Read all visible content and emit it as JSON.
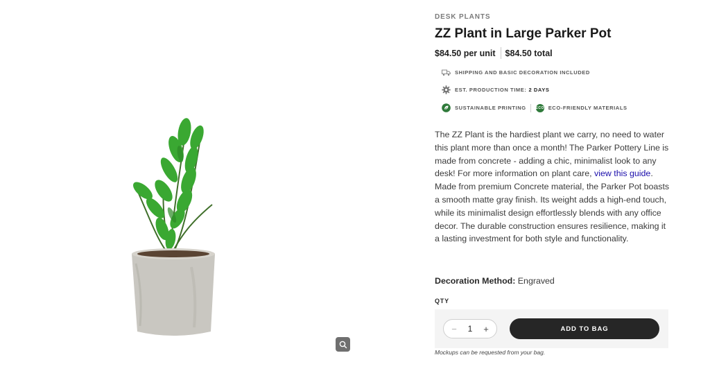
{
  "product": {
    "category": "DESK PLANTS",
    "title": "ZZ Plant in Large Parker Pot",
    "price_unit": "$84.50 per unit",
    "price_total": "$84.50 total"
  },
  "features": {
    "shipping": "SHIPPING AND BASIC DECORATION INCLUDED",
    "production_label": "EST. PRODUCTION TIME:",
    "production_value": "2 DAYS",
    "sustainable": "SUSTAINABLE PRINTING",
    "eco_badge": "ECO",
    "eco": "ECO-FRIENDLY MATERIALS"
  },
  "description": {
    "p1_text": "The ZZ Plant is the hardiest plant we carry, no need to water this plant more than once a month! The Parker Pottery Line is made from concrete - adding a chic, minimalist look to any desk! For more information on plant care, ",
    "p1_link": "view this guide",
    "p1_end": ".",
    "p2": "Made from premium Concrete material, the Parker Pot boasts a smooth matte gray finish. Its weight adds a high-end touch, while its minimalist design effortlessly blends with any office decor. The durable construction ensures resilience, making it a lasting investment for both style and functionality."
  },
  "decoration": {
    "label": "Decoration Method:",
    "value": " Engraved"
  },
  "purchase": {
    "qty_label": "QTY",
    "qty_value": "1",
    "minus": "−",
    "plus": "+",
    "add_label": "ADD TO BAG",
    "note": "Mockups can be requested from your bag."
  },
  "icons": {
    "truck": "truck-icon",
    "gear": "gear-icon",
    "leaf": "leaf-icon",
    "zoom": "magnifier-icon"
  },
  "colors": {
    "accent_dark": "#262626",
    "eco_green": "#2f7a3a",
    "link": "#1a0dab"
  }
}
